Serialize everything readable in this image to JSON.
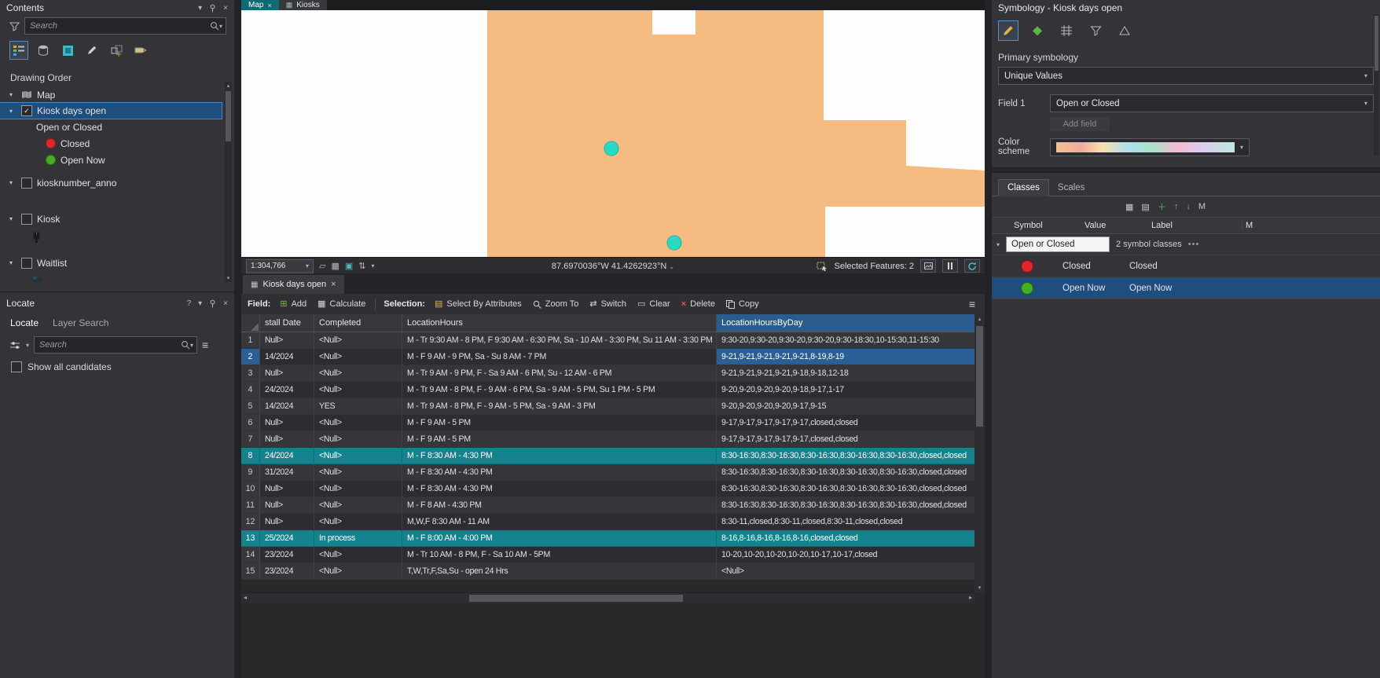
{
  "colors": {
    "selection_teal": "#15838e",
    "selection_blue": "#2a5f95",
    "tree_selection_blue": "#1d4e7e",
    "polygon_orange": "#f6bb80",
    "selected_feature_cyan": "#2ad9c2",
    "closed_red": "#e1252b",
    "open_now_green": "#44af21",
    "byday_header_blue": "#2a5d8e"
  },
  "contents_pane": {
    "title": "Contents",
    "search_placeholder": "Search",
    "drawing_order_heading": "Drawing Order",
    "tree": {
      "map": "Map",
      "kiosk_days_open": "Kiosk days open",
      "field_heading": "Open or Closed",
      "closed": "Closed",
      "open_now": "Open Now",
      "kiosknumber_anno": "kiosknumber_anno",
      "kiosk": "Kiosk",
      "waitlist": "Waitlist"
    }
  },
  "locate_pane": {
    "title": "Locate",
    "help": "?",
    "tab_locate": "Locate",
    "tab_layer_search": "Layer Search",
    "search_placeholder": "Search",
    "show_all_candidates": "Show all candidates"
  },
  "map_view": {
    "tab_map": "Map",
    "tab_kiosks": "Kiosks",
    "status": {
      "scale": "1:304,766",
      "coordinates": "87.6970036°W 41.4262923°N",
      "selected_features": "Selected Features: 2"
    }
  },
  "attribute_table": {
    "tab_title": "Kiosk days open",
    "toolbar": {
      "field_group_label": "Field:",
      "add": "Add",
      "calculate": "Calculate",
      "selection_group_label": "Selection:",
      "select_by_attributes": "Select By Attributes",
      "zoom_to": "Zoom To",
      "switch": "Switch",
      "clear": "Clear",
      "delete": "Delete",
      "copy": "Copy"
    },
    "columns": {
      "install_date": "stall Date",
      "completed": "Completed",
      "location_hours": "LocationHours",
      "location_hours_by_day": "LocationHoursByDay"
    },
    "rows": [
      {
        "num": "1",
        "date": "Null>",
        "completed": "<Null>",
        "hours": "M - Tr 9:30 AM - 8 PM, F 9:30 AM - 6:30 PM, Sa - 10 AM - 3:30 PM, Su 11 AM - 3:30 PM",
        "byday": "9:30-20,9:30-20,9:30-20,9:30-20,9:30-18:30,10-15:30,11-15:30",
        "edge": "9",
        "state": "normal"
      },
      {
        "num": "2",
        "date": "14/2024",
        "completed": "<Null>",
        "hours": "M - F 9 AM - 9 PM, Sa - Su 8 AM - 7 PM",
        "byday": "9-21,9-21,9-21,9-21,9-21,8-19,8-19",
        "edge": "8",
        "state": "active-cell"
      },
      {
        "num": "3",
        "date": "Null>",
        "completed": "<Null>",
        "hours": "M - Tr 9 AM - 9 PM, F - Sa 9 AM - 6 PM, Su - 12 AM - 6 PM",
        "byday": "9-21,9-21,9-21,9-21,9-18,9-18,12-18",
        "edge": "9",
        "state": "normal"
      },
      {
        "num": "4",
        "date": "24/2024",
        "completed": "<Null>",
        "hours": "M - Tr 9 AM - 8 PM, F - 9 AM - 6 PM, Sa - 9 AM - 5 PM, Su 1 PM - 5 PM",
        "byday": "9-20,9-20,9-20,9-20,9-18,9-17,1-17",
        "edge": "9",
        "state": "normal"
      },
      {
        "num": "5",
        "date": "14/2024",
        "completed": "YES",
        "hours": "M - Tr 9 AM - 8 PM, F - 9 AM - 5 PM, Sa - 9 AM - 3 PM",
        "byday": "9-20,9-20,9-20,9-20,9-17,9-15",
        "edge": "9",
        "state": "normal"
      },
      {
        "num": "6",
        "date": "Null>",
        "completed": "<Null>",
        "hours": "M - F 9 AM - 5 PM",
        "byday": "9-17,9-17,9-17,9-17,9-17,closed,closed",
        "edge": "9",
        "state": "normal"
      },
      {
        "num": "7",
        "date": "Null>",
        "completed": "<Null>",
        "hours": "M - F 9 AM - 5 PM",
        "byday": "9-17,9-17,9-17,9-17,9-17,closed,closed",
        "edge": "9",
        "state": "normal"
      },
      {
        "num": "8",
        "date": "24/2024",
        "completed": "<Null>",
        "hours": "M - F 8:30 AM - 4:30 PM",
        "byday": "8:30-16:30,8:30-16:30,8:30-16:30,8:30-16:30,8:30-16:30,closed,closed",
        "edge": "8",
        "state": "selected"
      },
      {
        "num": "9",
        "date": "31/2024",
        "completed": "<Null>",
        "hours": "M - F 8:30 AM - 4:30 PM",
        "byday": "8:30-16:30,8:30-16:30,8:30-16:30,8:30-16:30,8:30-16:30,closed,closed",
        "edge": "8",
        "state": "normal"
      },
      {
        "num": "10",
        "date": "Null>",
        "completed": "<Null>",
        "hours": "M - F 8:30 AM - 4:30 PM",
        "byday": "8:30-16:30,8:30-16:30,8:30-16:30,8:30-16:30,8:30-16:30,closed,closed",
        "edge": "8",
        "state": "normal"
      },
      {
        "num": "11",
        "date": "Null>",
        "completed": "<Null>",
        "hours": "M - F 8 AM - 4:30 PM",
        "byday": "8:30-16:30,8:30-16:30,8:30-16:30,8:30-16:30,8:30-16:30,closed,closed",
        "edge": "8",
        "state": "normal"
      },
      {
        "num": "12",
        "date": "Null>",
        "completed": "<Null>",
        "hours": "M,W,F 8:30 AM - 11 AM",
        "byday": "8:30-11,closed,8:30-11,closed,8:30-11,closed,closed",
        "edge": "8",
        "state": "normal"
      },
      {
        "num": "13",
        "date": "25/2024",
        "completed": "In process",
        "hours": "M - F 8:00 AM - 4:00 PM",
        "byday": "8-16,8-16,8-16,8-16,8-16,closed,closed",
        "edge": "8",
        "state": "selected"
      },
      {
        "num": "14",
        "date": "23/2024",
        "completed": "<Null>",
        "hours": "M - Tr 10 AM - 8 PM, F - Sa 10 AM - 5PM",
        "byday": "10-20,10-20,10-20,10-20,10-17,10-17,closed",
        "edge": "1",
        "state": "normal"
      },
      {
        "num": "15",
        "date": "23/2024",
        "completed": "<Null>",
        "hours": "T,W,Tr,F,Sa,Su - open 24 Hrs",
        "byday": "<Null>",
        "edge": "",
        "state": "normal"
      }
    ]
  },
  "symbology_pane": {
    "title": "Symbology - Kiosk days open",
    "primary_symbology_label": "Primary symbology",
    "method": "Unique Values",
    "field1_label": "Field 1",
    "field1_value": "Open or Closed",
    "add_field_label": "Add field",
    "color_scheme_label": "Color scheme",
    "tab_classes": "Classes",
    "tab_scales": "Scales",
    "more_partial": "M",
    "grid": {
      "col_symbol": "Symbol",
      "col_value": "Value",
      "col_label": "Label",
      "col_more_partial": "M",
      "group_name": "Open or Closed",
      "group_count": "2 symbol classes",
      "group_more": "•••",
      "rows": [
        {
          "value": "Closed",
          "label": "Closed"
        },
        {
          "value": "Open Now",
          "label": "Open Now"
        }
      ]
    }
  }
}
